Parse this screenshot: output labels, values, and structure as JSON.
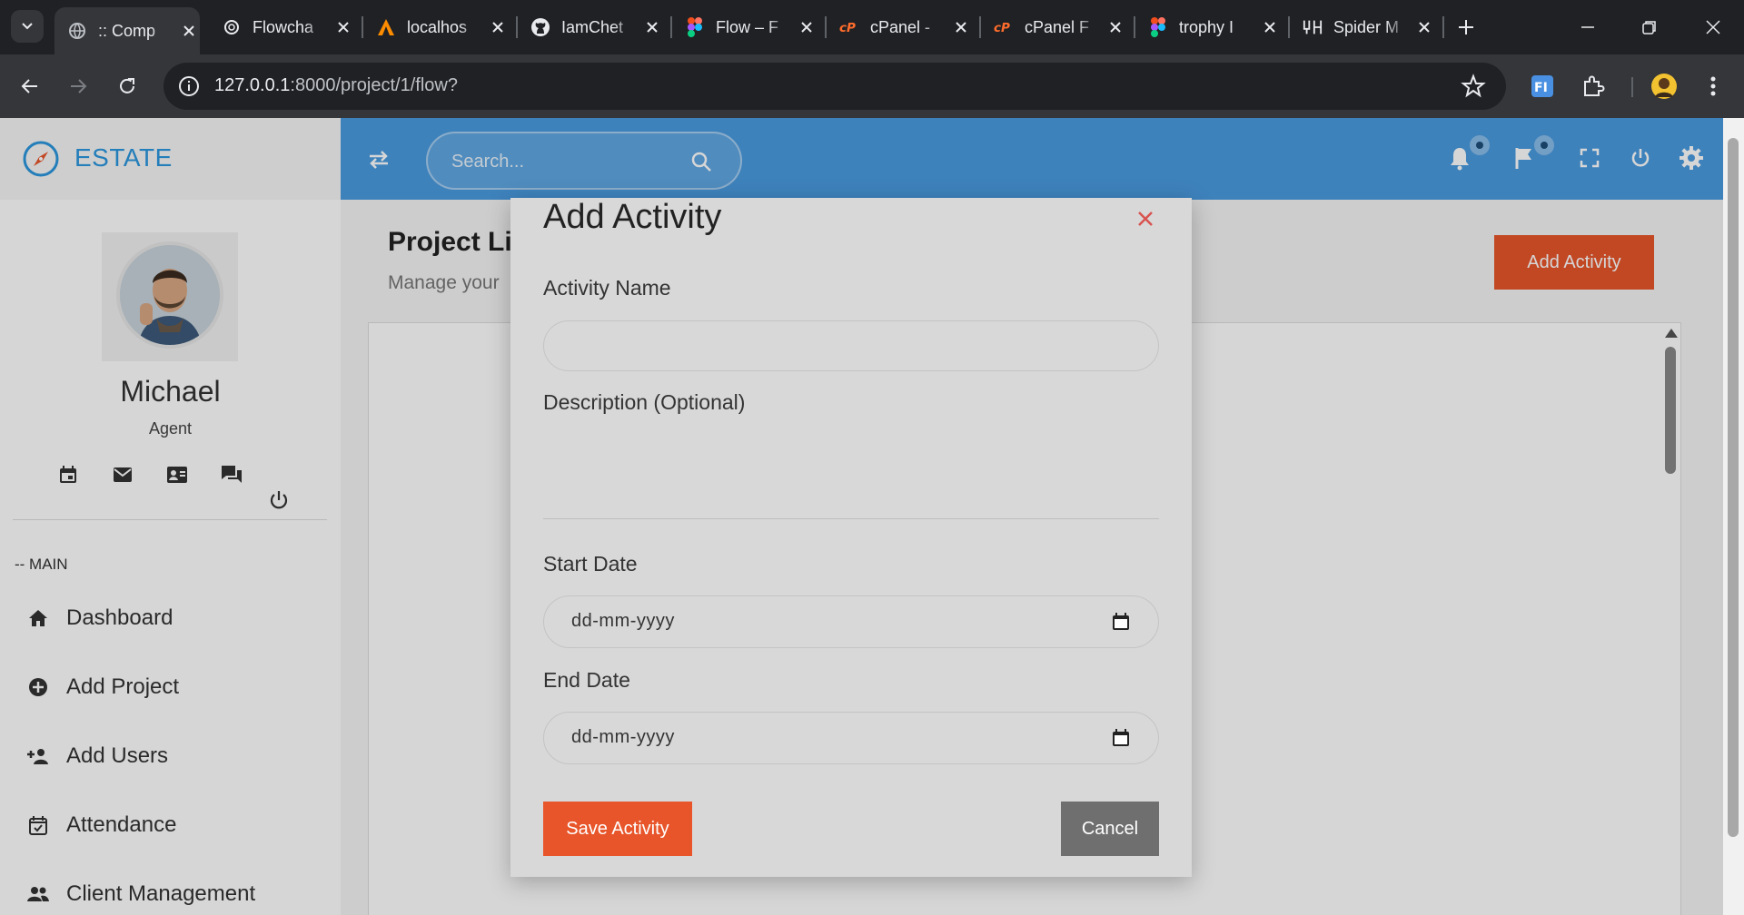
{
  "browser": {
    "tabs": [
      {
        "title": ":: Comp",
        "icon": "globe-icon",
        "active": true
      },
      {
        "title": "Flowcha",
        "icon": "openai-icon",
        "active": false
      },
      {
        "title": "localhos",
        "icon": "xampp-icon",
        "active": false
      },
      {
        "title": "IamChet",
        "icon": "github-icon",
        "active": false
      },
      {
        "title": "Flow – F",
        "icon": "figma-icon",
        "active": false
      },
      {
        "title": "cPanel -",
        "icon": "cpanel-icon",
        "active": false
      },
      {
        "title": "cPanel F",
        "icon": "cpanel-icon",
        "active": false
      },
      {
        "title": "trophy I",
        "icon": "figma-icon",
        "active": false
      },
      {
        "title": "Spider M",
        "icon": "spider-icon",
        "active": false
      }
    ],
    "url_host": "127.0.0.1",
    "url_path": ":8000/project/1/flow?"
  },
  "app": {
    "brand": "ESTATE",
    "search_placeholder": "Search...",
    "accent_color": "#4a9be0",
    "action_color": "#e8552a"
  },
  "sidebar": {
    "user_name": "Michael",
    "user_role": "Agent",
    "quick_icons": [
      "calendar-icon",
      "mail-icon",
      "contact-card-icon",
      "chat-icon",
      "power-icon"
    ],
    "section_label": "-- MAIN",
    "items": [
      {
        "label": "Dashboard",
        "icon": "home-icon"
      },
      {
        "label": "Add Project",
        "icon": "plus-circle-icon"
      },
      {
        "label": "Add Users",
        "icon": "add-user-icon"
      },
      {
        "label": "Attendance",
        "icon": "calendar-check-icon"
      },
      {
        "label": "Client Management",
        "icon": "people-icon"
      }
    ]
  },
  "page": {
    "title": "Project Lis",
    "subtitle": "Manage your",
    "add_activity_label": "Add Activity"
  },
  "modal": {
    "title": "Add Activity",
    "activity_name_label": "Activity Name",
    "activity_name_value": "",
    "description_label": "Description (Optional)",
    "description_value": "",
    "start_date_label": "Start Date",
    "start_date_value": "dd-mm-yyyy",
    "end_date_label": "End Date",
    "end_date_value": "dd-mm-yyyy",
    "save_label": "Save Activity",
    "cancel_label": "Cancel"
  }
}
